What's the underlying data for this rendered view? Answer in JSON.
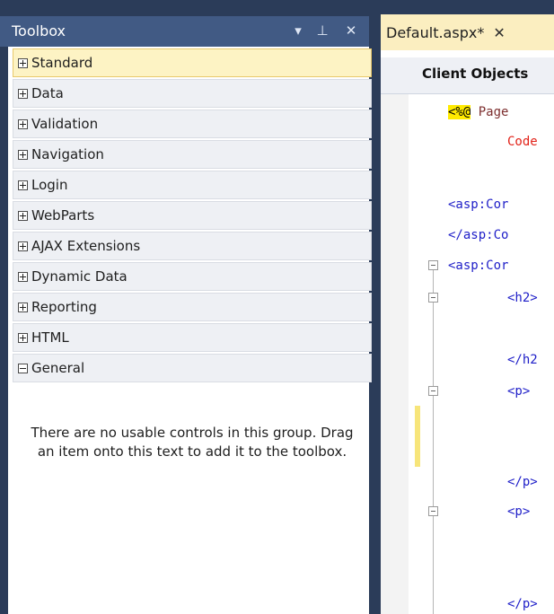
{
  "toolbox": {
    "title": "Toolbox",
    "buttons": {
      "dropdown": "▾",
      "pin": "⊥",
      "close": "✕"
    },
    "items": [
      {
        "label": "Standard",
        "expanded": false,
        "selected": true
      },
      {
        "label": "Data",
        "expanded": false
      },
      {
        "label": "Validation",
        "expanded": false
      },
      {
        "label": "Navigation",
        "expanded": false
      },
      {
        "label": "Login",
        "expanded": false
      },
      {
        "label": "WebParts",
        "expanded": false
      },
      {
        "label": "AJAX Extensions",
        "expanded": false
      },
      {
        "label": "Dynamic Data",
        "expanded": false
      },
      {
        "label": "Reporting",
        "expanded": false
      },
      {
        "label": "HTML",
        "expanded": false
      },
      {
        "label": "General",
        "expanded": true
      }
    ],
    "empty_message": "There are no usable controls in this group. Drag an item onto this text to add it to the toolbox."
  },
  "editor": {
    "tab_label": "Default.aspx*",
    "tab_close": "✕",
    "nav_dropdown": "Client Objects",
    "code": {
      "l1_directive": "<%@",
      "l1_page": " Page",
      "l2": "Code",
      "l3": "<asp:Cor",
      "l4": "</asp:Co",
      "l5": "<asp:Cor",
      "l6": "<h2>",
      "l7": "</h2",
      "l8": "<p>",
      "l9": "</p>",
      "l10": "<p>",
      "l11": "</p>"
    }
  }
}
